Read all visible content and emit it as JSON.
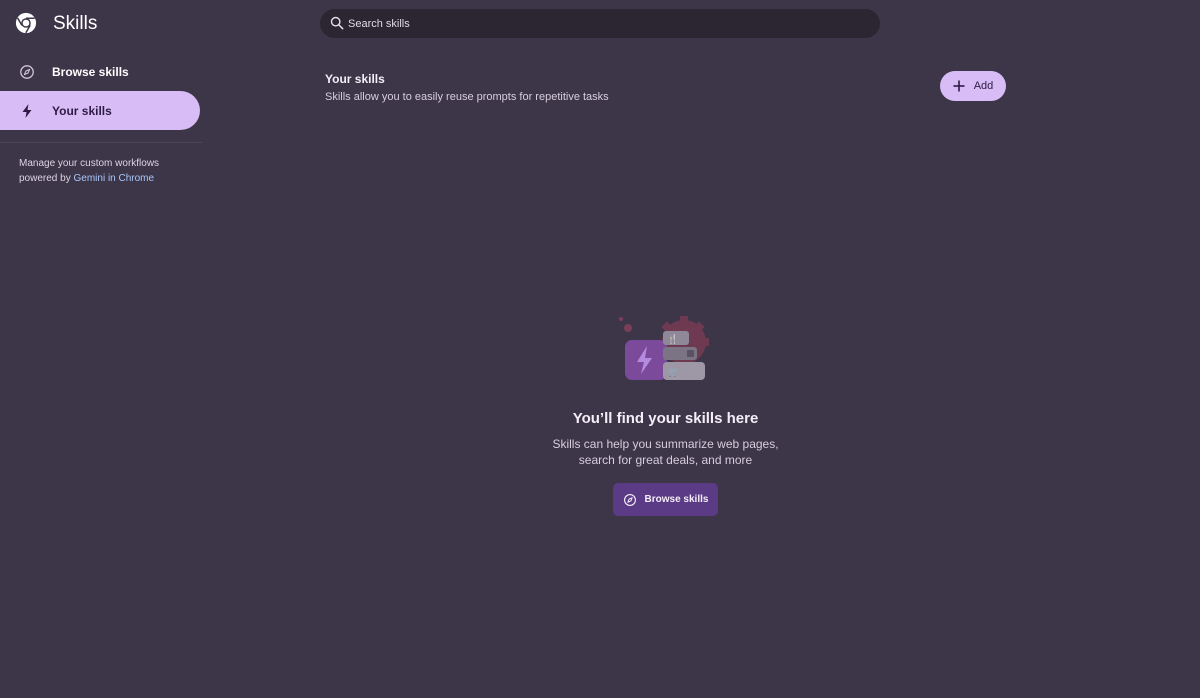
{
  "app": {
    "title": "Skills"
  },
  "search": {
    "placeholder": "Search skills",
    "value": ""
  },
  "sidebar": {
    "items": [
      {
        "label": "Browse skills",
        "icon": "compass-icon",
        "selected": false
      },
      {
        "label": "Your skills",
        "icon": "lightning-icon",
        "selected": true
      }
    ],
    "note_text": "Manage your custom workflows powered by",
    "note_link": "Gemini in Chrome"
  },
  "main": {
    "title": "Your skills",
    "subtitle": "Skills allow you to easily reuse prompts for repetitive tasks",
    "add_label": "Add"
  },
  "empty_state": {
    "title": "You’ll find your skills here",
    "line1": "Skills can help you summarize web pages,",
    "line2": "search for great deals, and more",
    "button_label": "Browse skills"
  },
  "colors": {
    "background": "#3d3548",
    "accent": "#d7bcf6",
    "button_dark": "#5b3a86",
    "link": "#a8c7fa"
  }
}
